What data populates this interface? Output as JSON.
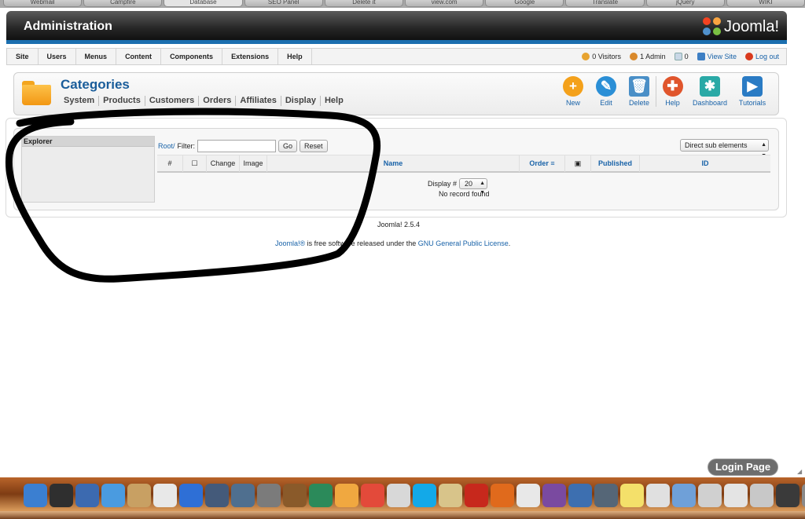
{
  "browser_tabs": [
    "Webmail",
    "Campfire",
    "Database",
    "SEO Panel",
    "Delete it",
    "view.com",
    "Google",
    "Translate",
    "jQuery",
    "WIKI"
  ],
  "header": {
    "title": "Administration",
    "logo_text": "Joomla!"
  },
  "menu": {
    "items": [
      "Site",
      "Users",
      "Menus",
      "Content",
      "Components",
      "Extensions",
      "Help"
    ],
    "status": {
      "visitors": "0 Visitors",
      "admins": "1 Admin",
      "messages": "0",
      "view_site": "View Site",
      "logout": "Log out"
    }
  },
  "page": {
    "title": "Categories",
    "submenu": [
      "System",
      "Products",
      "Customers",
      "Orders",
      "Affiliates",
      "Display",
      "Help"
    ]
  },
  "toolbar": {
    "buttons": [
      {
        "label": "New",
        "icon": "plus-icon",
        "color": "#f4a11b"
      },
      {
        "label": "Edit",
        "icon": "pencil-icon",
        "color": "#2b8fd6"
      },
      {
        "label": "Delete",
        "icon": "trash-icon",
        "color": "#4a8fc7"
      },
      {
        "label": "Help",
        "icon": "lifebuoy-icon",
        "color": "#e0552c"
      },
      {
        "label": "Dashboard",
        "icon": "dashboard-icon",
        "color": "#2aa9a6"
      },
      {
        "label": "Tutorials",
        "icon": "video-camera-icon",
        "color": "#2a7bc4"
      }
    ]
  },
  "explorer": {
    "title": "Explorer"
  },
  "filter": {
    "root_link": "Root/",
    "label": "Filter:",
    "value": "",
    "go": "Go",
    "reset": "Reset",
    "select_value": "Direct sub elements"
  },
  "table": {
    "headers": {
      "num": "#",
      "change": "Change",
      "image": "Image",
      "name": "Name",
      "order": "Order",
      "published": "Published",
      "id": "ID"
    },
    "display_label": "Display #",
    "display_value": "20",
    "empty_message": "No record found"
  },
  "footer": {
    "version": "Joomla! 2.5.4",
    "license_prefix": "Joomla!®",
    "license_text": " is free software released under the ",
    "license_link": "GNU General Public License",
    "license_suffix": "."
  },
  "dock": {
    "tooltip": "Login Page",
    "icons": [
      "finder",
      "dashboard",
      "preview",
      "safari",
      "contacts",
      "calendar",
      "itunes",
      "spaces",
      "time-machine",
      "system-preferences",
      "iphoto",
      "feather",
      "flower",
      "acrobat",
      "acrobat-2",
      "skype",
      "script-editor",
      "filezilla",
      "firefox",
      "notes",
      "photo-app",
      "iphoto-2",
      "camera",
      "stickies",
      "documents",
      "downloads",
      "browser",
      "papers",
      "folder-2",
      "login-page",
      "trash"
    ]
  },
  "colors": {
    "link": "#1862a8",
    "header_bar": "#1b6fb0",
    "title": "#1a5d9a"
  }
}
